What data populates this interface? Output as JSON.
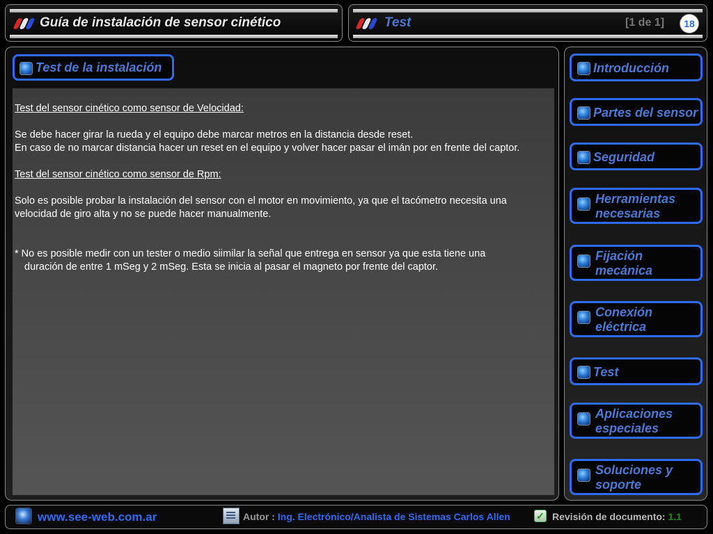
{
  "header_left": {
    "title": "Guía de instalación de sensor cinético"
  },
  "header_right": {
    "title": "Test",
    "page_indicator": "[1 de 1]",
    "page_number": "18"
  },
  "section": {
    "title": "Test de la instalación"
  },
  "content": {
    "heading1": "Test del sensor cinético como sensor de Velocidad:",
    "para1_line1": "Se debe hacer girar la rueda y el equipo debe marcar metros en la distancia desde reset.",
    "para1_line2": "En caso de no marcar distancia hacer un reset en el equipo y volver hacer pasar el imán por en frente del captor.",
    "heading2": "Test del sensor cinético como sensor de Rpm:",
    "para2": "Solo es posible probar la instalación del sensor con el motor en movimiento, ya que el tacómetro necesita una velocidad de giro alta y no se puede hacer manualmente.",
    "note_line1": "* No es posible medir con un tester o medio siimilar la señal que entrega en sensor ya que esta tiene una",
    "note_line2": "duración de entre 1 mSeg y 2 mSeg. Esta se inicia al pasar el magneto por frente del captor."
  },
  "nav": {
    "items": [
      {
        "label": "Introducción"
      },
      {
        "label": "Partes del sensor"
      },
      {
        "label": "Seguridad"
      },
      {
        "label": "Herramientas necesarias"
      },
      {
        "label": "Fijación mecánica"
      },
      {
        "label": "Conexión eléctrica"
      },
      {
        "label": "Test"
      },
      {
        "label": "Aplicaciones especiales"
      },
      {
        "label": "Soluciones y soporte"
      }
    ]
  },
  "footer": {
    "url": "www.see-web.com.ar",
    "author_label": "Autor :",
    "author_name": "Ing. Electrónico/Analista de Sistemas Carlos Allen",
    "revision_label": "Revisión de documento:",
    "revision_value": "1.1"
  },
  "colors": {
    "accent": "#2f6bf0",
    "label_blue": "#4a7ad6",
    "revision_green": "#1f8a1f"
  },
  "icons": [
    "flag-stripes-icon",
    "section-icon",
    "globe-icon",
    "document-icon",
    "check-icon"
  ]
}
